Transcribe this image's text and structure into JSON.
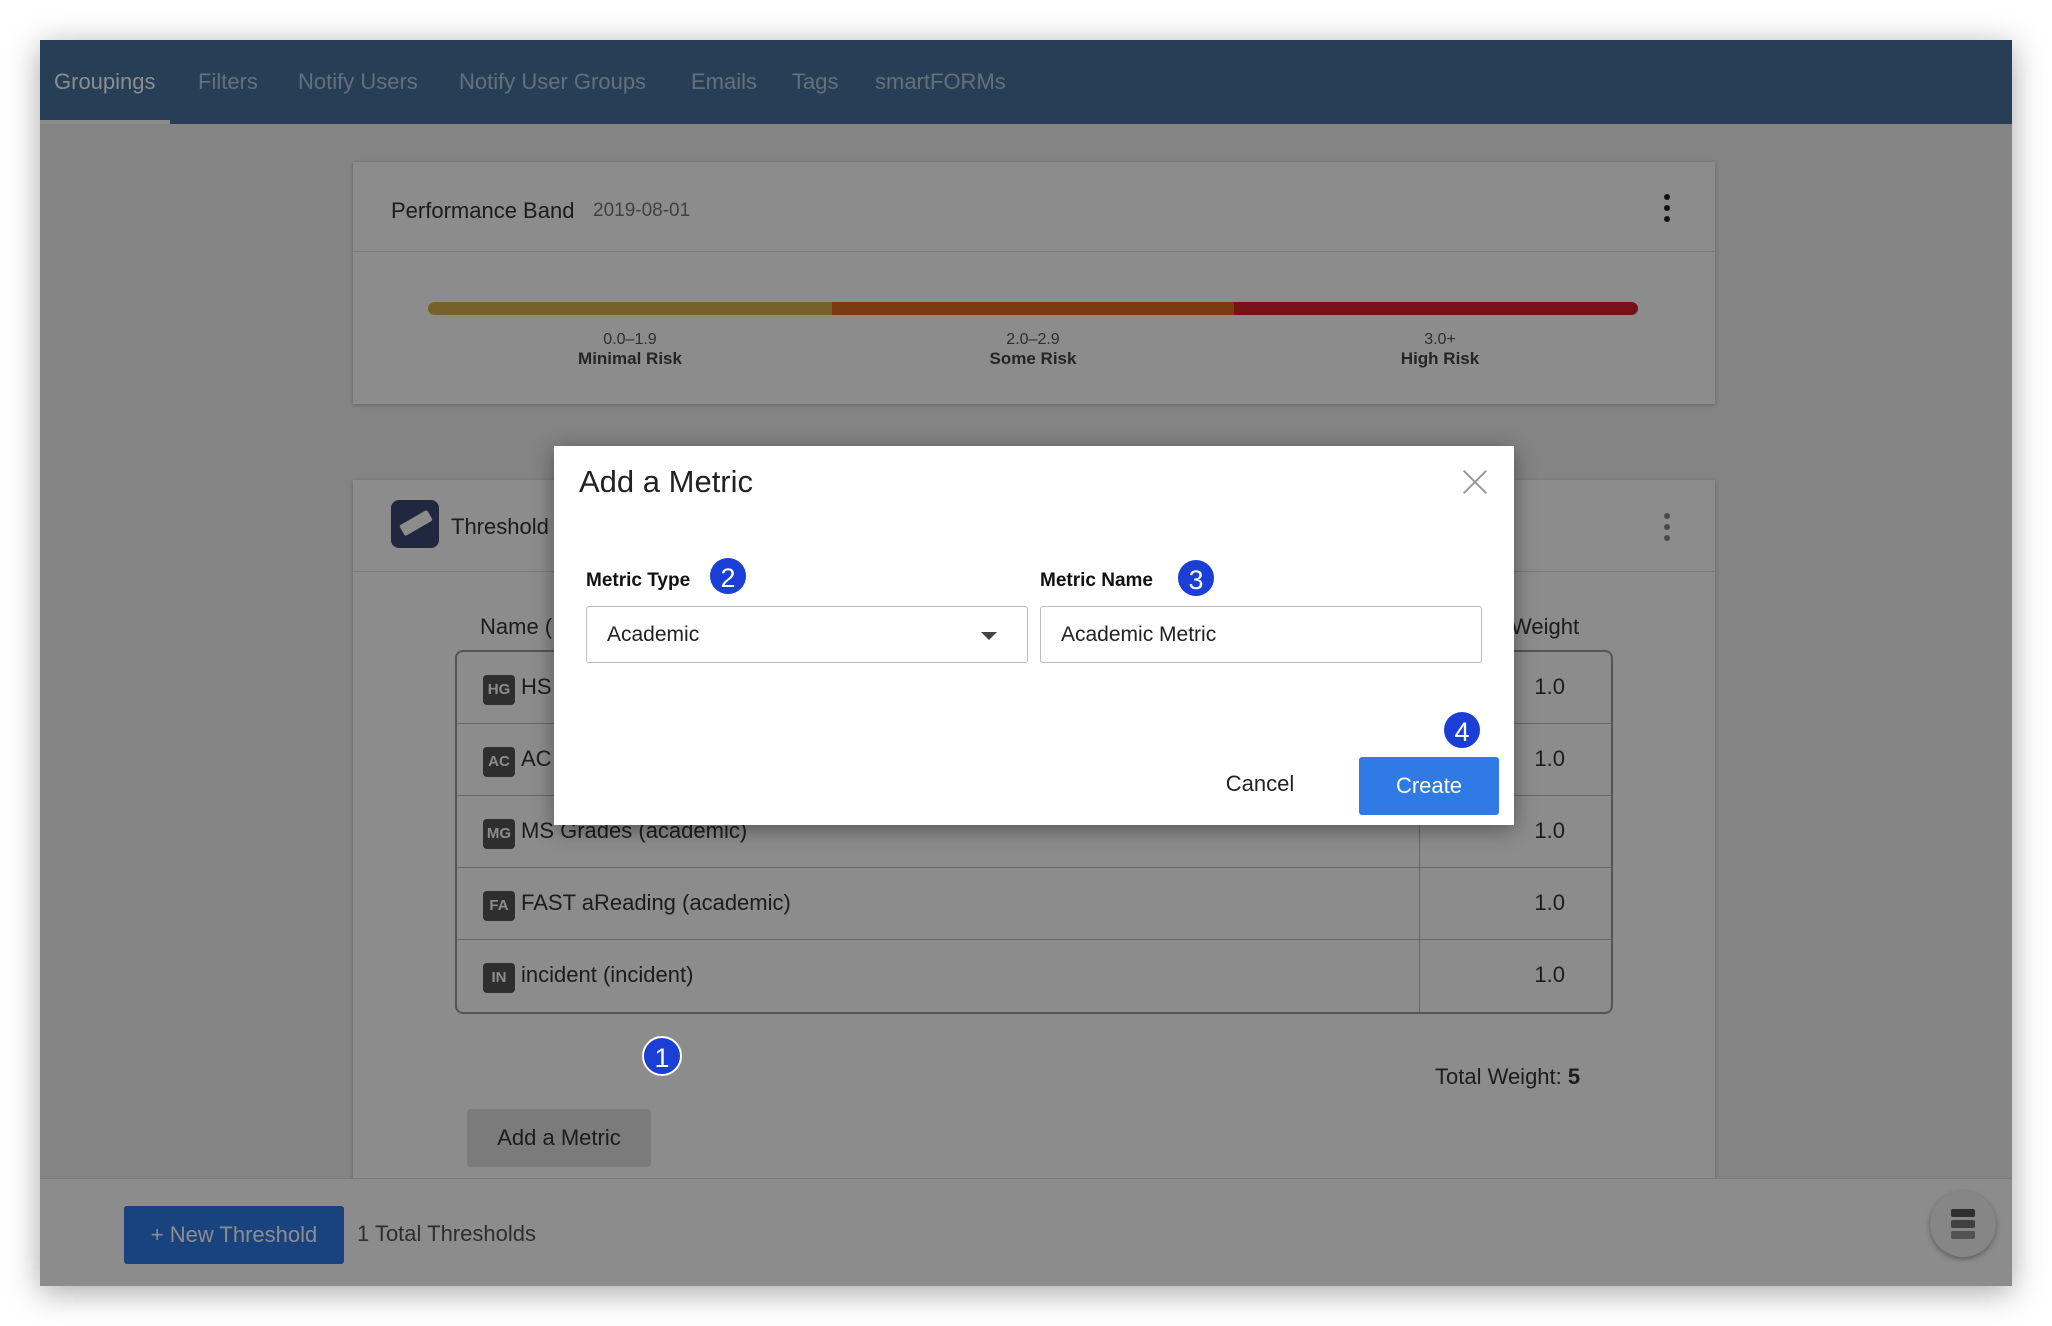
{
  "nav": {
    "tabs": [
      {
        "label": "Groupings",
        "active": true
      },
      {
        "label": "Filters"
      },
      {
        "label": "Notify Users"
      },
      {
        "label": "Notify User Groups"
      },
      {
        "label": "Emails"
      },
      {
        "label": "Tags"
      },
      {
        "label": "smartFORMs"
      }
    ]
  },
  "performance_band": {
    "title": "Performance Band",
    "date": "2019-08-01",
    "bands": [
      {
        "range": "0.0–1.9",
        "label": "Minimal Risk",
        "color": "#d7b34a"
      },
      {
        "range": "2.0–2.9",
        "label": "Some Risk",
        "color": "#e06c1c"
      },
      {
        "range": "3.0+",
        "label": "High Risk",
        "color": "#d6222a"
      }
    ]
  },
  "threshold": {
    "title": "Threshold",
    "name_header": "Name (",
    "weight_header": "Weight",
    "metrics": [
      {
        "abbr": "HG",
        "name": "HS",
        "weight": "1.0"
      },
      {
        "abbr": "AC",
        "name": "AC",
        "weight": "1.0"
      },
      {
        "abbr": "MG",
        "name": "MS Grades (academic)",
        "weight": "1.0"
      },
      {
        "abbr": "FA",
        "name": "FAST aReading (academic)",
        "weight": "1.0"
      },
      {
        "abbr": "IN",
        "name": "incident (incident)",
        "weight": "1.0"
      }
    ],
    "total_weight_label": "Total Weight:",
    "total_weight_value": "5",
    "add_metric_label": "Add a Metric"
  },
  "footer": {
    "new_threshold_label": "+ New Threshold",
    "total_thresholds": "1 Total Thresholds"
  },
  "modal": {
    "title": "Add a Metric",
    "metric_type_label": "Metric Type",
    "metric_type_value": "Academic",
    "metric_name_label": "Metric Name",
    "metric_name_value": "Academic Metric",
    "cancel_label": "Cancel",
    "create_label": "Create"
  },
  "steps": [
    "1",
    "2",
    "3",
    "4"
  ],
  "colors": {
    "navbar": "#46739f",
    "primary_button": "#2f7ae5",
    "step_badge": "#1b3fd6"
  }
}
